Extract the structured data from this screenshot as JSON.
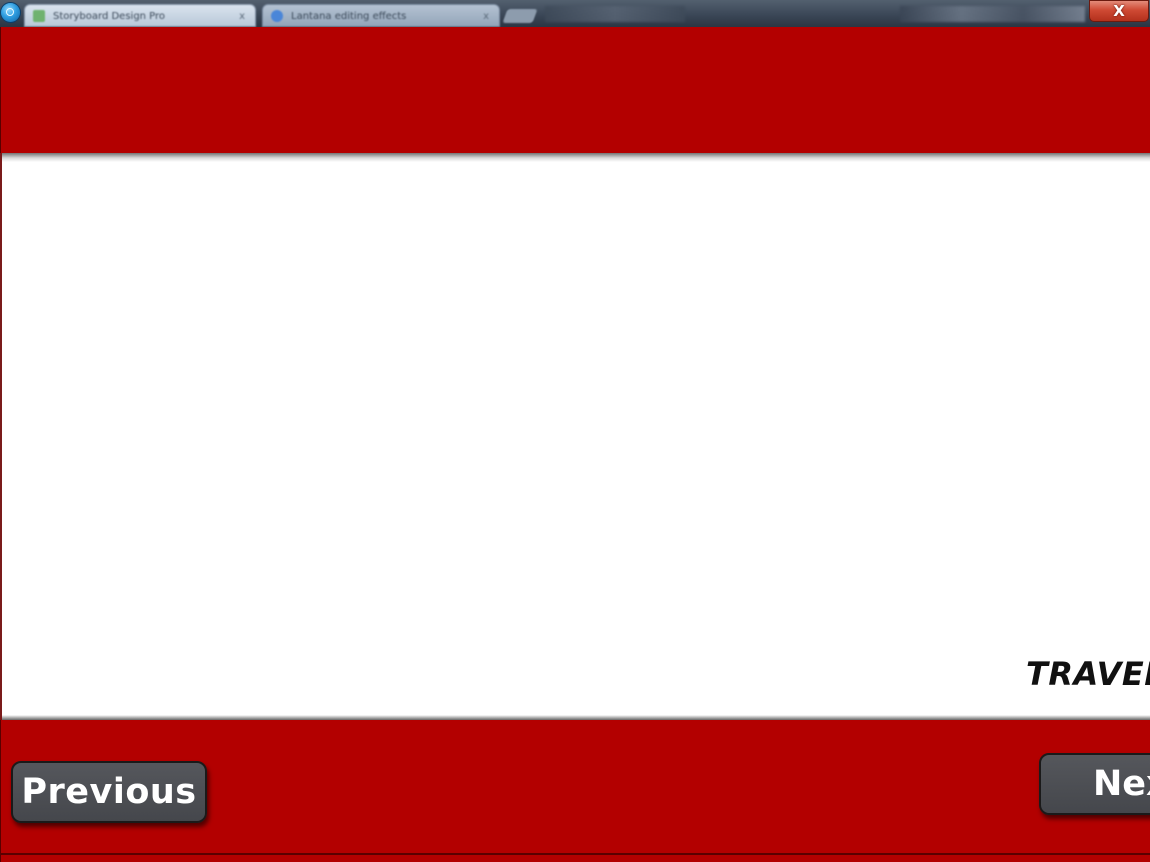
{
  "window": {
    "tabs": [
      {
        "label": "Storyboard Design Pro",
        "close_glyph": "x"
      },
      {
        "label": "Lantana editing effects",
        "close_glyph": "x"
      }
    ],
    "close_glyph": "X"
  },
  "content": {
    "travel_label": "TRAVEL"
  },
  "nav": {
    "previous_label": "Previous",
    "next_label": "Next"
  },
  "colors": {
    "band_red": "#b30000",
    "button_gray": "#4b4d52",
    "content_bg": "#ffffff"
  },
  "icons": [
    "app-globe-icon",
    "tab-favicon",
    "window-close-icon"
  ]
}
